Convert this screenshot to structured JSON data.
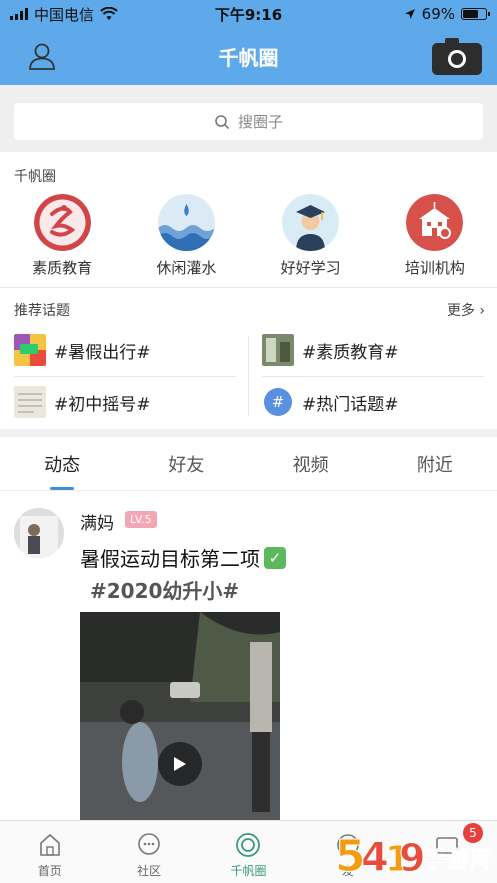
{
  "status_bar": {
    "carrier": "中国电信",
    "time": "下午9:16",
    "battery": "69%",
    "battery_level": 0.69
  },
  "header": {
    "title": "千帆圈",
    "user_icon": "user-icon",
    "camera_icon": "camera-icon"
  },
  "search": {
    "placeholder": "搜圈子"
  },
  "circles": {
    "section_label": "千帆圈",
    "items": [
      {
        "label": "素质教育",
        "icon": "quality-education-icon"
      },
      {
        "label": "休闲灌水",
        "icon": "water-waves-icon"
      },
      {
        "label": "好好学习",
        "icon": "graduate-icon"
      },
      {
        "label": "培训机构",
        "icon": "school-building-icon"
      }
    ]
  },
  "topics": {
    "section_label": "推荐话题",
    "more_label": "更多",
    "items": [
      {
        "label": "#暑假出行#"
      },
      {
        "label": "#素质教育#"
      },
      {
        "label": "#初中摇号#"
      },
      {
        "label": "#热门话题#"
      }
    ]
  },
  "feed": {
    "tabs": [
      "动态",
      "好友",
      "视频",
      "附近"
    ],
    "active_tab": "动态",
    "post": {
      "author": "满妈",
      "level": "LV.5",
      "text": "暑假运动目标第二项",
      "tag": "#2020幼升小#"
    }
  },
  "bottom_nav": {
    "items": [
      {
        "label": "首页",
        "icon": "home-icon"
      },
      {
        "label": "社区",
        "icon": "chat-icon"
      },
      {
        "label": "千帆圈",
        "icon": "circle-icon"
      },
      {
        "label": "发",
        "icon": "publish-icon"
      },
      {
        "label": "",
        "icon": "message-icon",
        "badge": "5"
      }
    ]
  },
  "watermark": {
    "text": "手游网"
  },
  "colors": {
    "header_bg": "#5da9ea",
    "active_tab_indicator": "#3a8fd9",
    "active_nav": "#3a9a7a",
    "level_badge": "#f3a7b4",
    "notification_badge": "#e5403b"
  }
}
